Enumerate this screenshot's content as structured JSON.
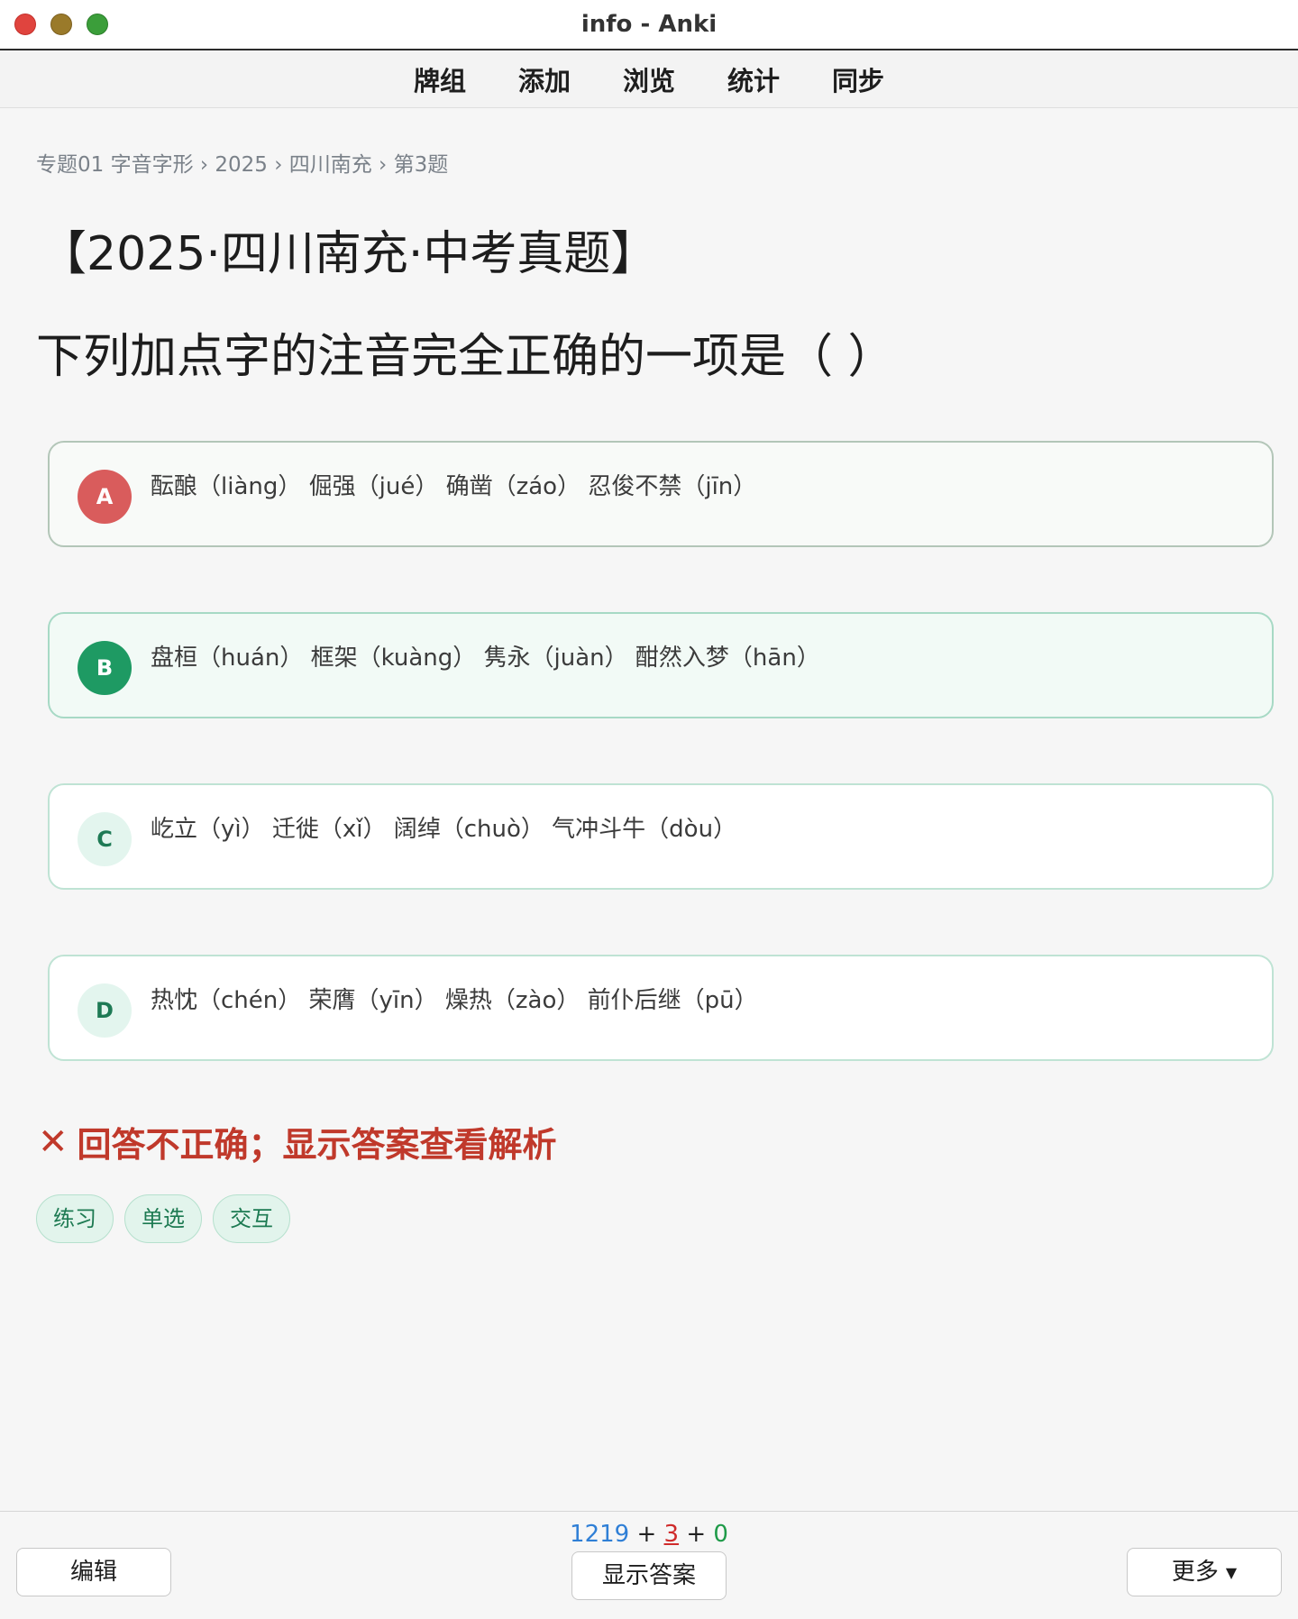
{
  "window": {
    "title": "info - Anki"
  },
  "toolbar": {
    "items": [
      "牌组",
      "添加",
      "浏览",
      "统计",
      "同步"
    ]
  },
  "breadcrumb": "专题01 字音字形 › 2025 › 四川南充 › 第3题",
  "card": {
    "heading": "【2025·四川南充·中考真题】",
    "question": "下列加点字的注音完全正确的一项是（ ）",
    "options": [
      {
        "letter": "A",
        "text": "酝酿（liàng） 倔强（jué） 确凿（záo） 忍俊不禁（jīn）",
        "state": "wrong"
      },
      {
        "letter": "B",
        "text": "盘桓（huán） 框架（kuàng） 隽永（juàn） 酣然入梦（hān）",
        "state": "correct"
      },
      {
        "letter": "C",
        "text": "屹立（yì） 迁徙（xǐ） 阔绰（chuò） 气冲斗牛（dòu）",
        "state": "neutral"
      },
      {
        "letter": "D",
        "text": "热忱（chén） 荣膺（yīn） 燥热（zào） 前仆后继（pū）",
        "state": "neutral"
      }
    ],
    "feedback": "回答不正确；显示答案查看解析",
    "feedback_icon": "close-icon",
    "tags": [
      "练习",
      "单选",
      "交互"
    ]
  },
  "bottom": {
    "counts": {
      "new": "1219",
      "learn": "3",
      "review": "0",
      "plus": "+"
    },
    "edit_label": "编辑",
    "show_answer_label": "显示答案",
    "more_label": "更多"
  },
  "colors": {
    "wrong_badge": "#d95c5c",
    "correct_badge": "#1e9a63",
    "feedback": "#c0392b",
    "count_new": "#2f7fd6",
    "count_learn": "#cf2b2b",
    "count_review": "#1e9a48"
  }
}
